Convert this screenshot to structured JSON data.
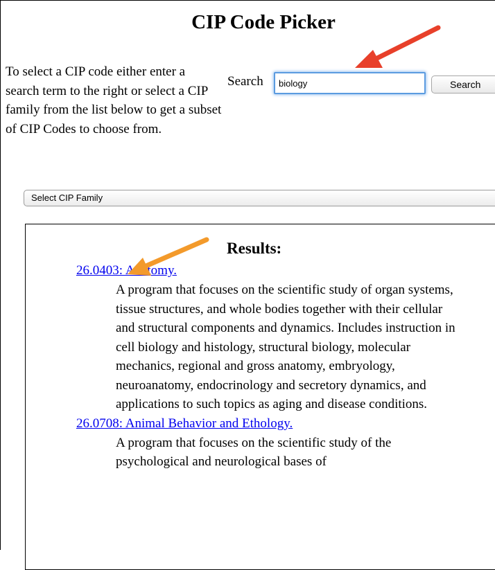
{
  "page": {
    "title": "CIP Code Picker",
    "intro": "To select a CIP code either enter a search term to the right or select a CIP family from the list below to get a subset of CIP Codes to choose from."
  },
  "search": {
    "label": "Search",
    "value": "biology",
    "button_label": "Search"
  },
  "family_select": {
    "selected": "Select CIP Family"
  },
  "results": {
    "heading": "Results:",
    "items": [
      {
        "code_title": "26.0403: Anatomy.",
        "description": "A program that focuses on the scientific study of organ systems, tissue structures, and whole bodies together with their cellular and structural components and dynamics. Includes instruction in cell biology and histology, structural biology, molecular mechanics, regional and gross anatomy, embryology, neuroanatomy, endocrinology and secretory dynamics, and applications to such topics as aging and disease conditions."
      },
      {
        "code_title": "26.0708: Animal Behavior and Ethology.",
        "description": "A program that focuses on the scientific study of the psychological and neurological bases of"
      }
    ]
  },
  "annotations": {
    "red_arrow_color": "#e8402a",
    "orange_arrow_color": "#f39a2b"
  }
}
